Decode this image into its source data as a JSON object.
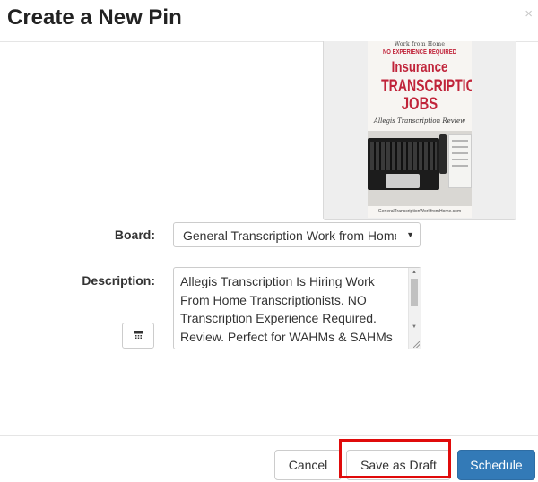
{
  "dialog": {
    "title": "Create a New Pin",
    "close_glyph": "×"
  },
  "pin_image": {
    "top_text": "Work from Home",
    "no_experience": "NO EXPERIENCE REQUIRED",
    "title_line1": "Insurance",
    "title_line2": "TRANSCRIPTION",
    "title_line3": "JOBS",
    "subtitle": "Allegis Transcription Review",
    "footer_url": "GeneralTranscriptionWorkfromHome.com",
    "accent_color": "#c0243a"
  },
  "form": {
    "board_label": "Board:",
    "board_value": "General Transcription Work from Home",
    "description_label": "Description:",
    "description_value": "Allegis Transcription Is Hiring Work From Home Transcriptionists. NO Transcription Experience Required. Review. Perfect for WAHMs & SAHMs",
    "calendar_icon": "calendar-icon"
  },
  "footer": {
    "cancel_label": "Cancel",
    "save_draft_label": "Save as Draft",
    "schedule_label": "Schedule",
    "primary_color": "#337ab7",
    "highlight_color": "#e00b0b"
  }
}
